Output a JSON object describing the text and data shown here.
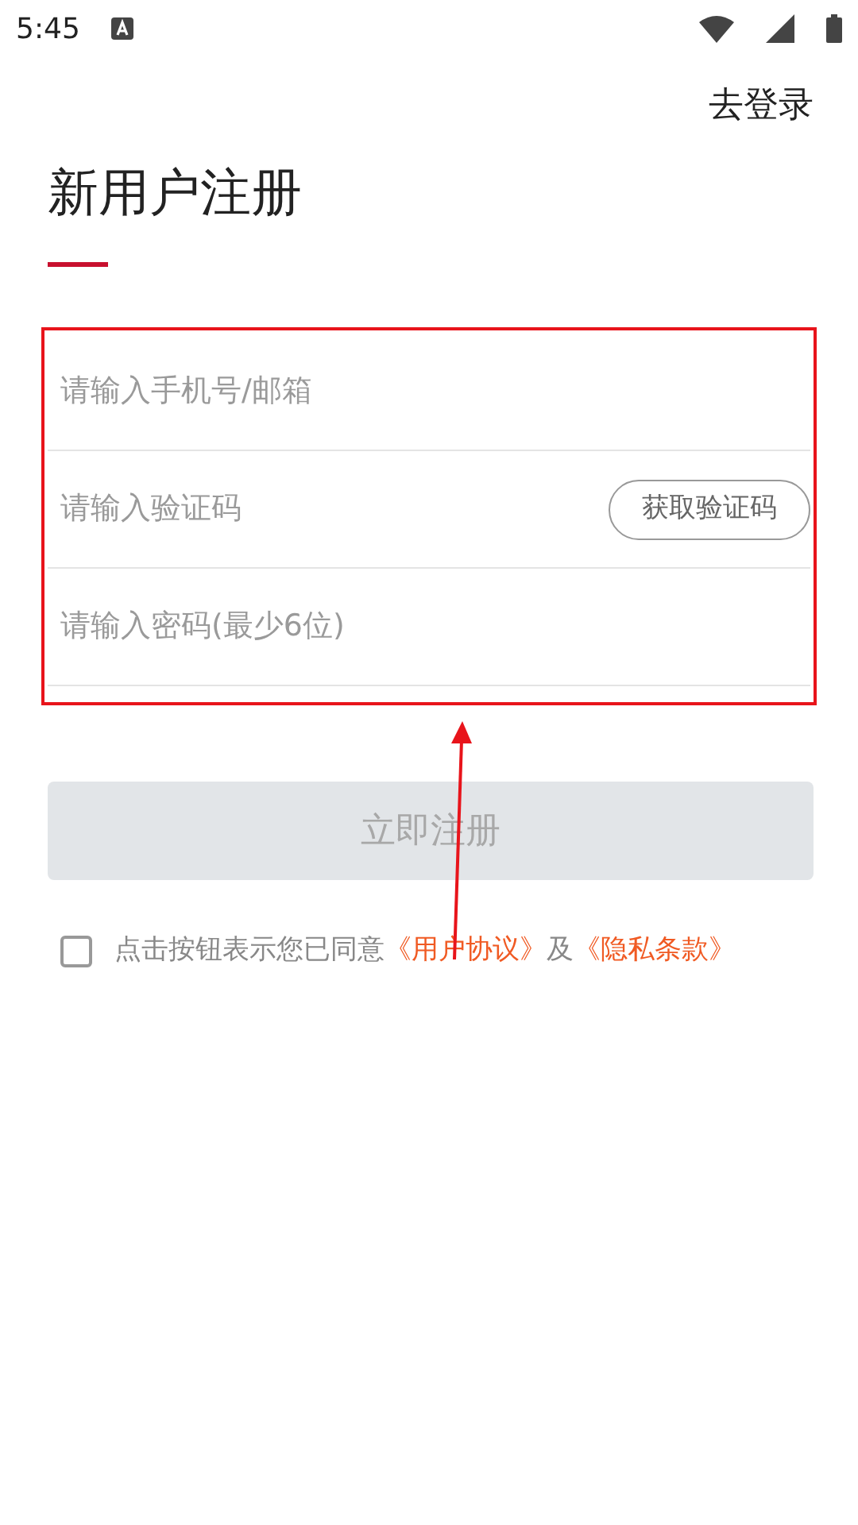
{
  "status_bar": {
    "time": "5:45"
  },
  "login_link": "去登录",
  "title": "新用户注册",
  "fields": [
    {
      "kind": "text",
      "placeholder": "请输入手机号/邮箱"
    },
    {
      "kind": "code",
      "placeholder": "请输入验证码",
      "button": "获取验证码"
    },
    {
      "kind": "password",
      "placeholder": "请输入密码(最少6位)"
    }
  ],
  "register_button": {
    "label": "立即注册",
    "disabled": true
  },
  "agreement": {
    "checked": false,
    "prefix": "点击按钮表示您已同意",
    "terms_link": "《用户协议》",
    "conjunction": "及",
    "privacy_link": "《隐私条款》"
  }
}
